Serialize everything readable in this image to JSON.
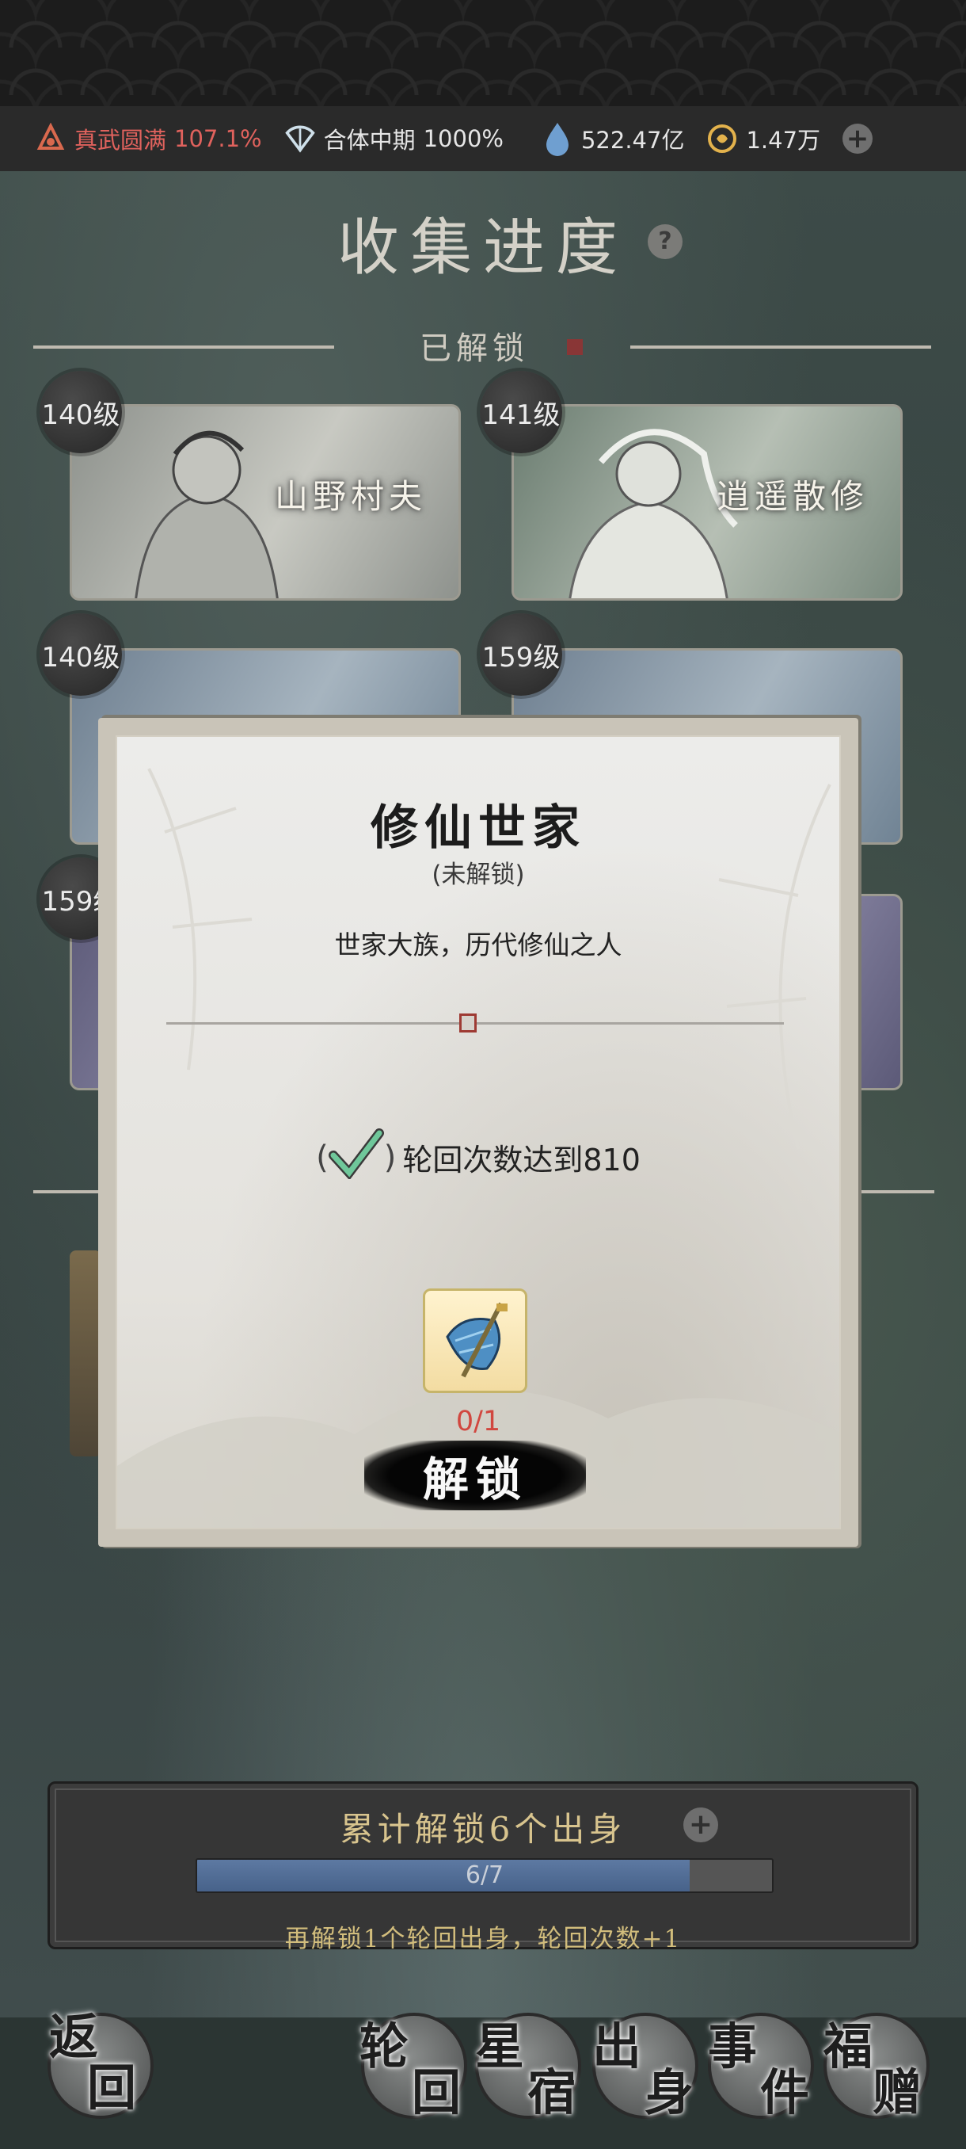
{
  "resources": [
    {
      "icon": "realm-icon",
      "label": "真武圆满",
      "value": "107.1%"
    },
    {
      "icon": "fan-icon",
      "label": "合体中期",
      "value": "1000%"
    },
    {
      "icon": "spirit-stone-icon",
      "label": "",
      "value": "522.47亿"
    },
    {
      "icon": "coin-icon",
      "label": "",
      "value": "1.47万"
    }
  ],
  "page": {
    "title": "收集进度",
    "section_unlocked": "已解锁"
  },
  "cards": [
    {
      "level": "140级",
      "name": "山野村夫"
    },
    {
      "level": "141级",
      "name": "逍遥散修"
    },
    {
      "level": "140级",
      "name": ""
    },
    {
      "level": "159级",
      "name": ""
    },
    {
      "level": "159级",
      "name": ""
    }
  ],
  "modal": {
    "title": "修仙世家",
    "status": "(未解锁)",
    "description": "世家大族，历代修仙之人",
    "requirement_open": "(",
    "requirement_close": ")",
    "requirement": "轮回次数达到810",
    "reward_count": "0/1",
    "unlock_label": "解锁"
  },
  "progress": {
    "title": "累计解锁6个出身",
    "bar_text": "6/7",
    "fraction": 0.857,
    "note": "再解锁1个轮回出身，轮回次数+1"
  },
  "nav": {
    "back": [
      "返",
      "回"
    ],
    "items": [
      {
        "chars": [
          "轮",
          "回"
        ]
      },
      {
        "chars": [
          "星",
          "宿"
        ]
      },
      {
        "chars": [
          "出",
          "身"
        ]
      },
      {
        "chars": [
          "事",
          "件"
        ]
      },
      {
        "chars": [
          "福",
          "赠"
        ]
      }
    ]
  },
  "colors": {
    "accent_red": "#e0625d",
    "gold_text": "#d8c48e",
    "bar_fill": "#5d79a2"
  }
}
